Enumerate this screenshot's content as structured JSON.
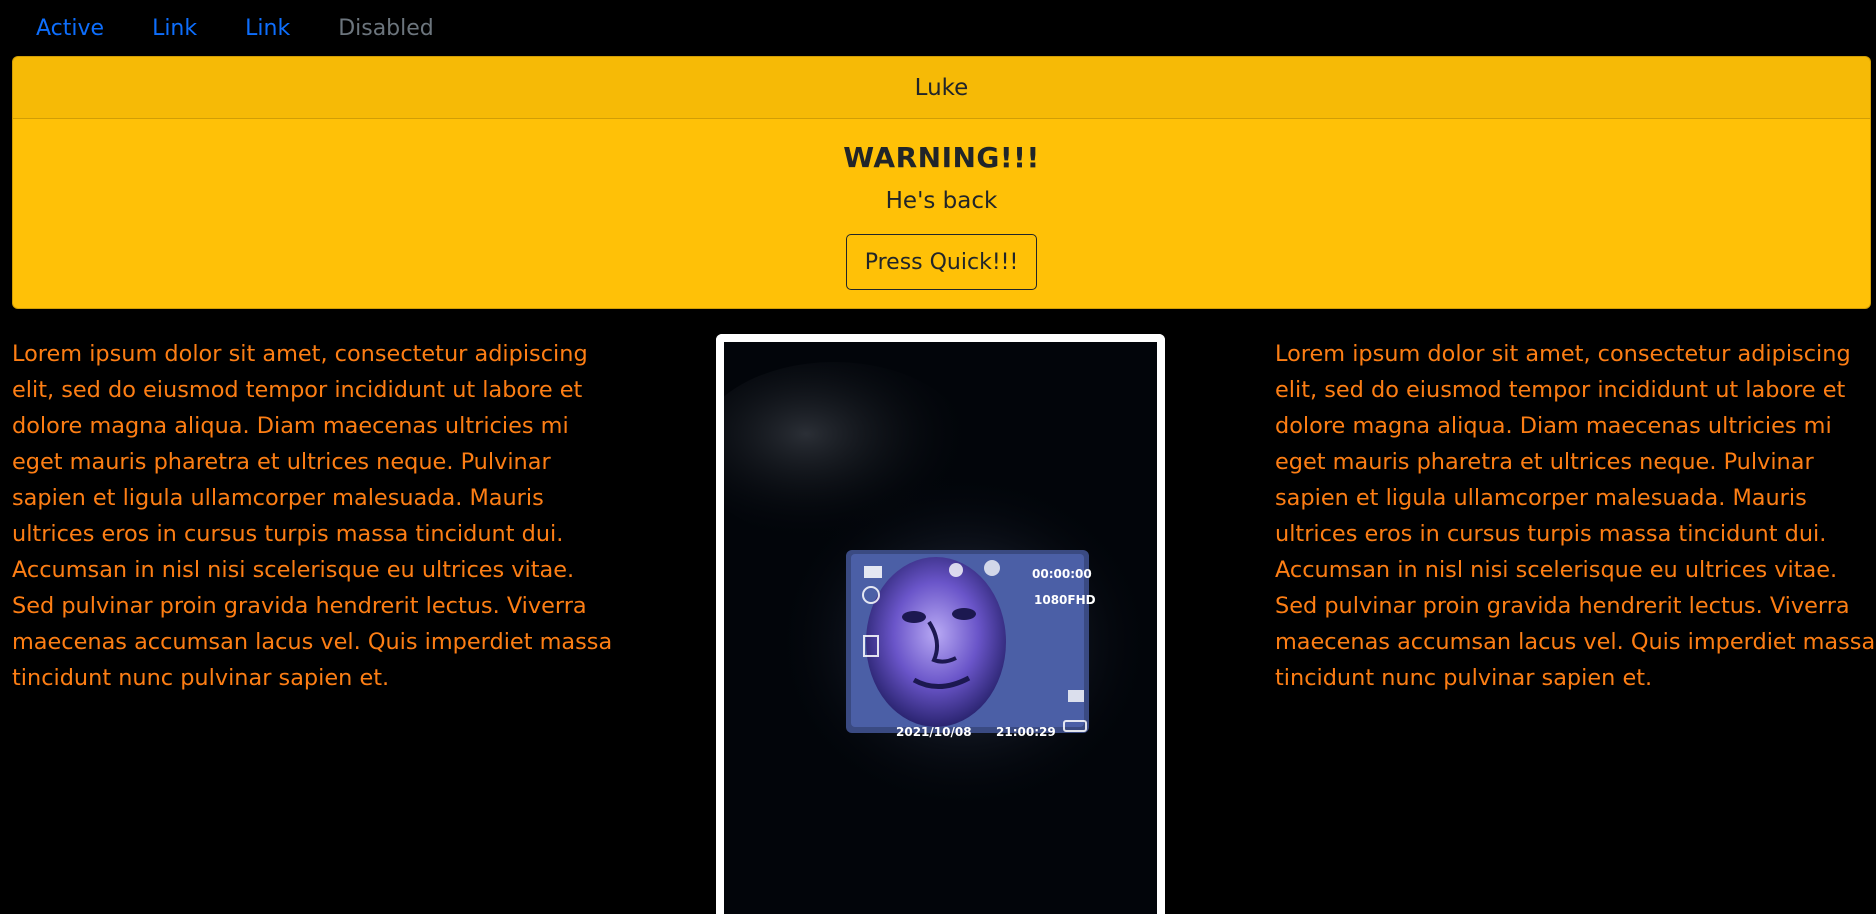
{
  "nav": {
    "items": [
      {
        "label": "Active"
      },
      {
        "label": "Link"
      },
      {
        "label": "Link"
      },
      {
        "label": "Disabled"
      }
    ]
  },
  "card": {
    "header": "Luke",
    "title": "WARNING!!!",
    "text": "He's back",
    "button_label": "Press Quick!!!"
  },
  "photo": {
    "screen_time": "00:00:00",
    "screen_resolution": "1080FHD",
    "screen_date": "2021/10/08",
    "screen_clock": "21:00:29"
  },
  "columns": {
    "left_text": "Lorem ipsum dolor sit amet, consectetur adipiscing elit, sed do eiusmod tempor incididunt ut labore et dolore magna aliqua. Diam maecenas ultricies mi eget mauris pharetra et ultrices neque. Pulvinar sapien et ligula ullamcorper malesuada. Mauris ultrices eros in cursus turpis massa tincidunt dui. Accumsan in nisl nisi scelerisque eu ultrices vitae. Sed pulvinar proin gravida hendrerit lectus. Viverra maecenas accumsan lacus vel. Quis imperdiet massa tincidunt nunc pulvinar sapien et.",
    "right_text": "Lorem ipsum dolor sit amet, consectetur adipiscing elit, sed do eiusmod tempor incididunt ut labore et dolore magna aliqua. Diam maecenas ultricies mi eget mauris pharetra et ultrices neque. Pulvinar sapien et ligula ullamcorper malesuada. Mauris ultrices eros in cursus turpis massa tincidunt dui. Accumsan in nisl nisi scelerisque eu ultrices vitae. Sed pulvinar proin gravida hendrerit lectus. Viverra maecenas accumsan lacus vel. Quis imperdiet massa tincidunt nunc pulvinar sapien et."
  },
  "colors": {
    "background": "#000000",
    "nav_link": "#0d6efd",
    "nav_disabled": "#6c757d",
    "card_bg": "#ffc107",
    "column_text": "#fd7e14"
  }
}
